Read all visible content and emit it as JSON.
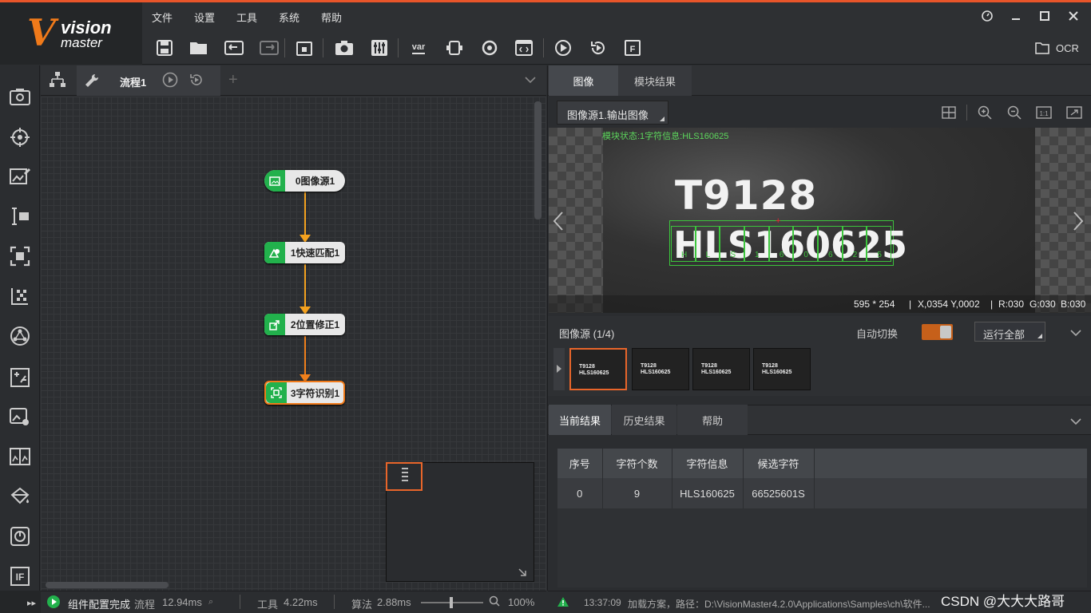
{
  "app": {
    "logo_big": "V",
    "logo_top": "vision",
    "logo_bottom": "master"
  },
  "menu": [
    "文件",
    "设置",
    "工具",
    "系统",
    "帮助"
  ],
  "toolbar": {
    "ocr_label": "OCR",
    "var_label": "var"
  },
  "flow": {
    "tab_label": "流程1",
    "nodes": [
      {
        "label": "0图像源1",
        "icon": "image-icon"
      },
      {
        "label": "1快速匹配1",
        "icon": "match-icon"
      },
      {
        "label": "2位置修正1",
        "icon": "position-fix-icon"
      },
      {
        "label": "3字符识别1",
        "icon": "ocr-icon"
      }
    ],
    "selected_node": 3
  },
  "status_left": {
    "message": "组件配置完成",
    "flow_label": "流程",
    "flow_time": "12.94ms",
    "tool_label": "工具",
    "tool_time": "4.22ms",
    "algo_label": "算法",
    "algo_time": "2.88ms",
    "zoom": "100%"
  },
  "right": {
    "tabs": [
      "图像",
      "模块结果"
    ],
    "active_tab": 0,
    "image_dropdown": "图像源1.输出图像",
    "overlay_status": "模块状态:1字符信息:HLS160625",
    "image_line1": "T9128",
    "image_line2": "HLS160625",
    "char_boxes": [
      "H",
      "L",
      "S",
      "1",
      "6",
      "0",
      "6",
      "2",
      "5"
    ],
    "image_info": {
      "size": "595 * 254",
      "coords": "X,0354  Y,0002",
      "r": "R:030",
      "g": "G:030",
      "b": "B:030"
    },
    "source_label": "图像源 (1/4)",
    "auto_switch_label": "自动切换",
    "run_all_label": "运行全部",
    "thumbnails": [
      {
        "l1": "T9128",
        "l2": "HLS160625"
      },
      {
        "l1": "T9128",
        "l2": "HLS160625"
      },
      {
        "l1": "T9128",
        "l2": "HLS160625"
      },
      {
        "l1": "T9128",
        "l2": "HLS160625"
      }
    ],
    "result_tabs": [
      "当前结果",
      "历史结果",
      "帮助"
    ],
    "table": {
      "headers": [
        "序号",
        "字符个数",
        "字符信息",
        "候选字符"
      ],
      "rows": [
        [
          "0",
          "9",
          "HLS160625",
          "66525601S"
        ]
      ]
    },
    "status": {
      "time": "13:37:09",
      "message": "加载方案，路径：D:\\VisionMaster4.2.0\\Applications\\Samples\\ch\\软件..."
    },
    "watermark": "CSDN @大大大路哥"
  },
  "colors": {
    "accent": "#e8552a",
    "node_green": "#22b14c",
    "connector": "#f4a21f",
    "match_box": "#3cc43c"
  }
}
